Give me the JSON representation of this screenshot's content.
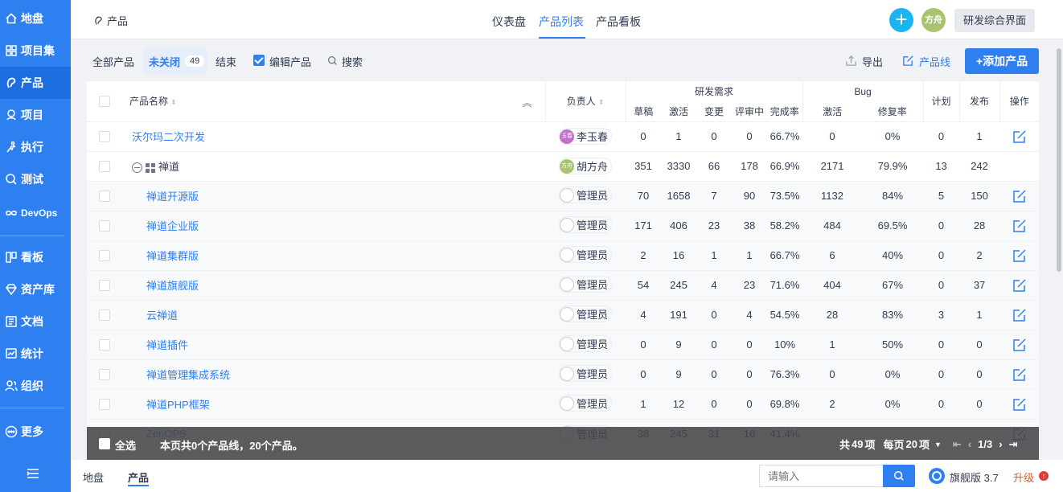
{
  "sidebar": {
    "items": [
      {
        "label": "地盘",
        "icon": "home-icon"
      },
      {
        "label": "项目集",
        "icon": "grid-icon"
      },
      {
        "label": "产品",
        "icon": "bulb-icon"
      },
      {
        "label": "项目",
        "icon": "bag-icon"
      },
      {
        "label": "执行",
        "icon": "run-icon"
      },
      {
        "label": "测试",
        "icon": "test-icon"
      },
      {
        "label": "DevOps",
        "icon": "infinity-icon"
      },
      {
        "label": "看板",
        "icon": "kanban-icon"
      },
      {
        "label": "资产库",
        "icon": "gem-icon"
      },
      {
        "label": "文档",
        "icon": "doc-icon"
      },
      {
        "label": "统计",
        "icon": "chart-icon"
      },
      {
        "label": "组织",
        "icon": "users-icon"
      },
      {
        "label": "更多",
        "icon": "more-icon"
      }
    ]
  },
  "header": {
    "breadcrumb": "产品",
    "tabs": [
      "仪表盘",
      "产品列表",
      "产品看板"
    ],
    "avatar": "方舟",
    "switch_label": "研发综合界面"
  },
  "toolbar": {
    "all": "全部产品",
    "unclosed": "未关闭",
    "unclosed_count": "49",
    "closed": "结束",
    "edit": "编辑产品",
    "search": "搜索",
    "export": "导出",
    "product_line": "产品线",
    "add": "+添加产品"
  },
  "table": {
    "headers": {
      "name": "产品名称",
      "owner": "负责人",
      "story_group": "研发需求",
      "bug_group": "Bug",
      "draft": "草稿",
      "active": "激活",
      "changed": "变更",
      "reviewing": "评审中",
      "completion": "完成率",
      "bug_active": "激活",
      "bug_fix_rate": "修复率",
      "plan": "计划",
      "release": "发布",
      "actions": "操作"
    },
    "rows": [
      {
        "name": "沃尔玛二次开发",
        "owner": "李玉春",
        "avatar": "玉春",
        "avatar_color": "#c270c8",
        "draft": "0",
        "active": "1",
        "changed": "0",
        "reviewing": "0",
        "completion": "66.7%",
        "bug_active": "0",
        "fix_rate": "0%",
        "plan": "0",
        "release": "1"
      },
      {
        "name": "禅道",
        "owner": "胡方舟",
        "avatar": "方舟",
        "avatar_color": "#a8c46e",
        "draft": "351",
        "active": "3330",
        "changed": "66",
        "reviewing": "178",
        "completion": "66.9%",
        "bug_active": "2171",
        "fix_rate": "79.9%",
        "plan": "13",
        "release": "242"
      },
      {
        "name": "禅道开源版",
        "owner": "管理员",
        "draft": "70",
        "active": "1658",
        "changed": "7",
        "reviewing": "90",
        "completion": "73.5%",
        "bug_active": "1132",
        "fix_rate": "84%",
        "plan": "5",
        "release": "150"
      },
      {
        "name": "禅道企业版",
        "owner": "管理员",
        "draft": "171",
        "active": "406",
        "changed": "23",
        "reviewing": "38",
        "completion": "58.2%",
        "bug_active": "484",
        "fix_rate": "69.5%",
        "plan": "0",
        "release": "28"
      },
      {
        "name": "禅道集群版",
        "owner": "管理员",
        "draft": "2",
        "active": "16",
        "changed": "1",
        "reviewing": "1",
        "completion": "66.7%",
        "bug_active": "6",
        "fix_rate": "40%",
        "plan": "0",
        "release": "2"
      },
      {
        "name": "禅道旗舰版",
        "owner": "管理员",
        "draft": "54",
        "active": "245",
        "changed": "4",
        "reviewing": "23",
        "completion": "71.6%",
        "bug_active": "404",
        "fix_rate": "67%",
        "plan": "0",
        "release": "37"
      },
      {
        "name": "云禅道",
        "owner": "管理员",
        "draft": "4",
        "active": "191",
        "changed": "0",
        "reviewing": "4",
        "completion": "54.5%",
        "bug_active": "28",
        "fix_rate": "83%",
        "plan": "3",
        "release": "1"
      },
      {
        "name": "禅道插件",
        "owner": "管理员",
        "draft": "0",
        "active": "9",
        "changed": "0",
        "reviewing": "0",
        "completion": "10%",
        "bug_active": "1",
        "fix_rate": "50%",
        "plan": "0",
        "release": "0"
      },
      {
        "name": "禅道管理集成系统",
        "owner": "管理员",
        "draft": "0",
        "active": "9",
        "changed": "0",
        "reviewing": "0",
        "completion": "76.3%",
        "bug_active": "0",
        "fix_rate": "0%",
        "plan": "0",
        "release": "0"
      },
      {
        "name": "禅道PHP框架",
        "owner": "管理员",
        "draft": "1",
        "active": "12",
        "changed": "0",
        "reviewing": "0",
        "completion": "69.8%",
        "bug_active": "2",
        "fix_rate": "0%",
        "plan": "0",
        "release": "0"
      },
      {
        "name": "ZenOPS",
        "owner": "管理员",
        "draft": "38",
        "active": "245",
        "changed": "31",
        "reviewing": "16",
        "completion": "41.4%",
        "bug_active": "",
        "fix_rate": "",
        "plan": "",
        "release": ""
      }
    ]
  },
  "footer": {
    "select_all": "全选",
    "summary": "本页共0个产品线，20个产品。",
    "total_prefix": "共",
    "total": "49",
    "total_suffix": "项",
    "per_page_prefix": "每页",
    "per_page": "20",
    "per_page_suffix": "项",
    "page": "1/3"
  },
  "bottom": {
    "tabs": [
      "地盘",
      "产品"
    ],
    "search_placeholder": "请输入",
    "edition": "旗舰版 3.7",
    "upgrade": "升级"
  },
  "colors": {
    "primary": "#2e7ff0",
    "sidebar": "#2e7ff0",
    "link": "#2e7ff0"
  }
}
